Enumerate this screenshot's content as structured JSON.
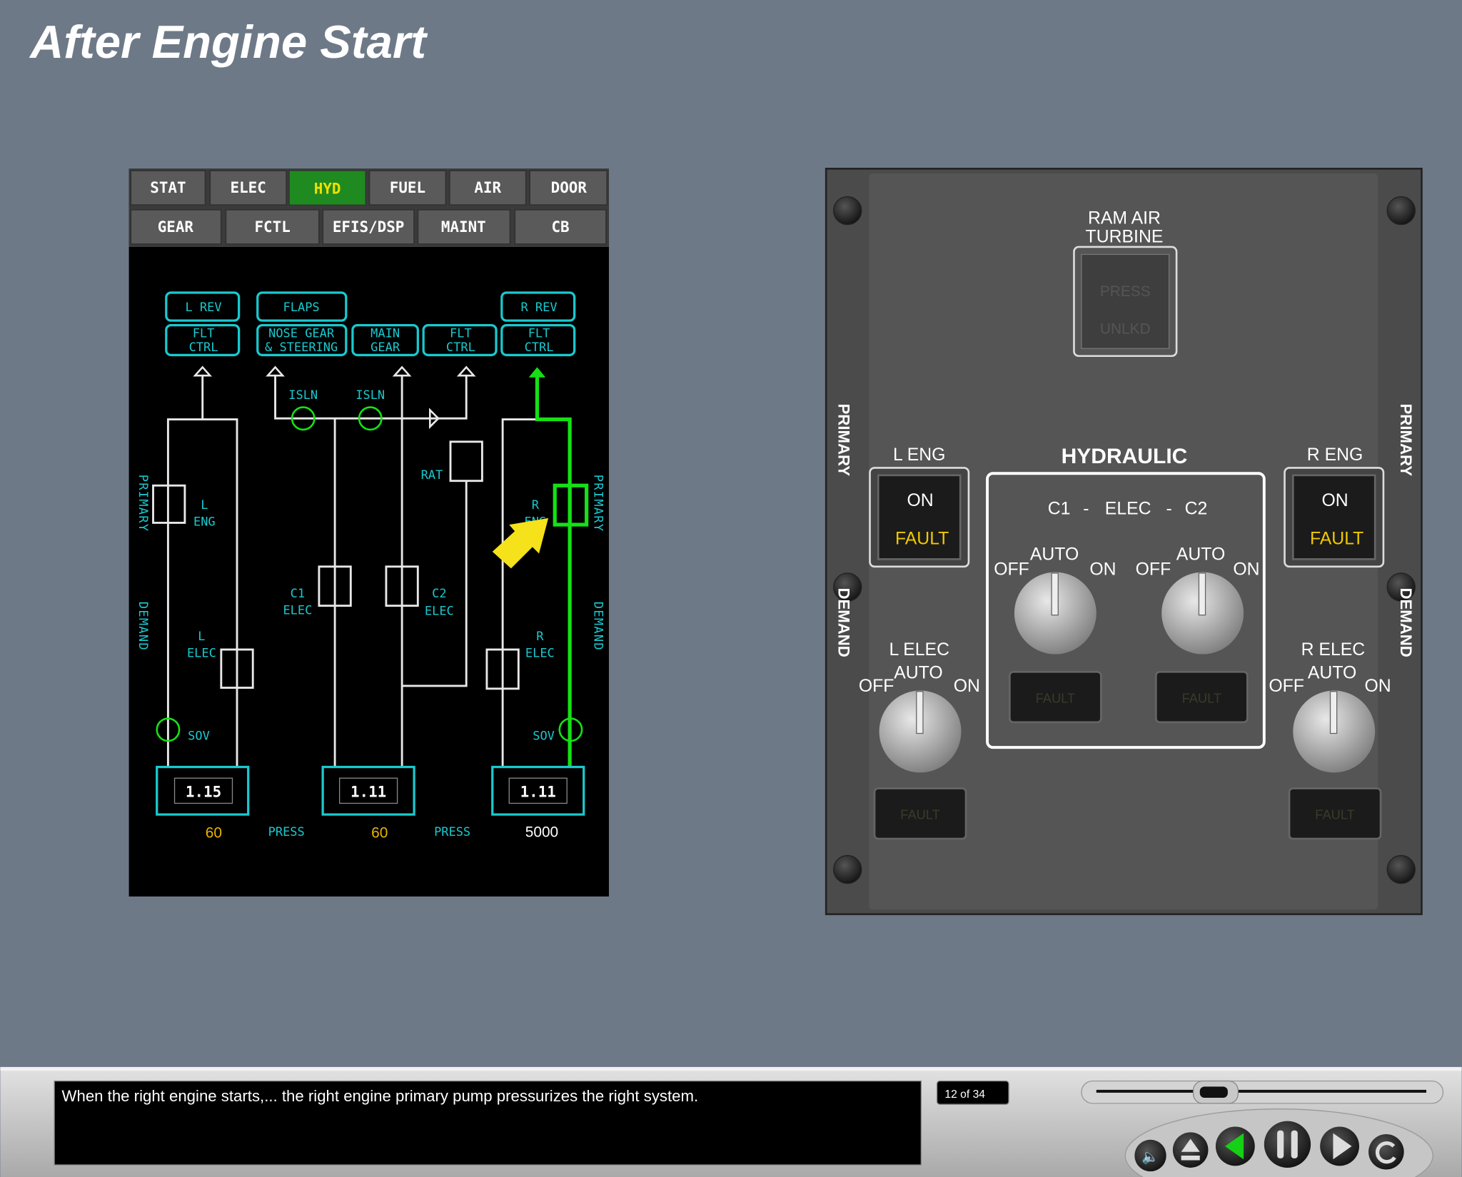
{
  "page_title": "After Engine Start",
  "eicas": {
    "tabs_row1": [
      "STAT",
      "ELEC",
      "HYD",
      "FUEL",
      "AIR",
      "DOOR"
    ],
    "tabs_row2": [
      "GEAR",
      "FCTL",
      "EFIS/DSP",
      "MAINT",
      "CB"
    ],
    "active_tab": "HYD",
    "consumers": {
      "l_rev": "L REV",
      "flaps": "FLAPS",
      "r_rev": "R REV",
      "l_flt1": "FLT",
      "l_flt2": "CTRL",
      "nose1": "NOSE GEAR",
      "nose2": "& STEERING",
      "main1": "MAIN",
      "main2": "GEAR",
      "c_flt1": "FLT",
      "c_flt2": "CTRL",
      "r_flt1": "FLT",
      "r_flt2": "CTRL"
    },
    "labels": {
      "isln": "ISLN",
      "rat": "RAT",
      "l_eng1": "L",
      "l_eng2": "ENG",
      "r_eng1": "R",
      "r_eng2": "ENG",
      "l_elec1": "L",
      "l_elec2": "ELEC",
      "r_elec1": "R",
      "r_elec2": "ELEC",
      "c1_1": "C1",
      "c1_2": "ELEC",
      "c2_1": "C2",
      "c2_2": "ELEC",
      "sov": "SOV",
      "primary": "PRIMARY",
      "demand": "DEMAND",
      "press": "PRESS"
    },
    "quantities": [
      "1.15",
      "1.11",
      "1.11"
    ],
    "pressures": [
      "60",
      "60",
      "5000"
    ],
    "colors": {
      "active_tab": "#1f8a1f",
      "pressurized": "#16e016",
      "cyan": "#19c9cf",
      "amber": "#e8b400",
      "pointer": "#f5e21a"
    }
  },
  "panel": {
    "ram_air_turbine": [
      "RAM AIR",
      "TURBINE"
    ],
    "rat_press": "PRESS",
    "rat_unlkd": "UNLKD",
    "hydraulic": "HYDRAULIC",
    "c1": "C1",
    "elec": "ELEC",
    "c2": "C2",
    "dash": "-",
    "l_eng": "L ENG",
    "r_eng": "R ENG",
    "on": "ON",
    "fault": "FAULT",
    "off": "OFF",
    "auto": "AUTO",
    "l_elec": "L ELEC",
    "r_elec": "R ELEC",
    "primary": "PRIMARY",
    "demand": "DEMAND"
  },
  "player": {
    "caption": "When the right engine starts,... the right engine primary pump pressurizes the right system.",
    "slide_counter": "12 of 34",
    "progress": 0.34,
    "buttons": [
      "audio",
      "eject",
      "back",
      "pause",
      "play",
      "replay"
    ]
  }
}
